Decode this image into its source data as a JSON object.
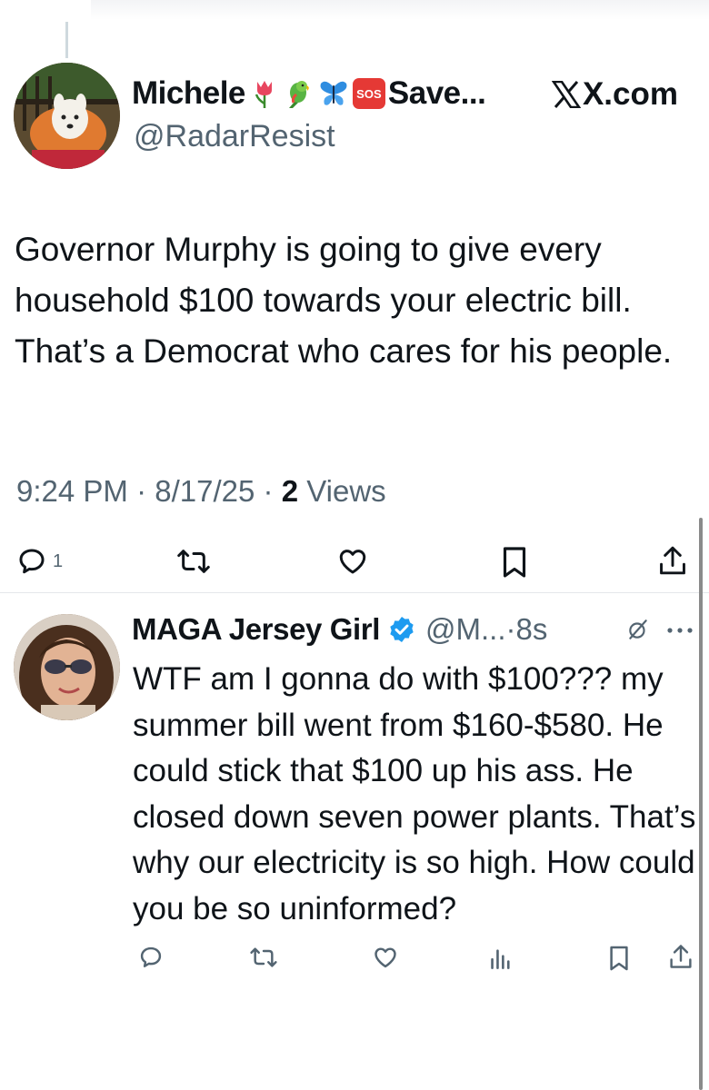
{
  "main_tweet": {
    "display_name": "Michele",
    "name_truncated": "Save...",
    "sos_label": "SOS",
    "emojis": [
      "tulip-emoji",
      "parrot-emoji",
      "butterfly-emoji"
    ],
    "handle": "@RadarResist",
    "source": "X.com",
    "text": "Governor Murphy is going to give every household $100 towards your electric bill. That’s a Democrat who cares for his people.",
    "time": "9:24 PM",
    "date": "8/17/25",
    "views_count": "2",
    "views_label": "Views",
    "separator": "·",
    "reply_count": "1"
  },
  "reply": {
    "display_name": "MAGA Jersey Girl",
    "handle": "@M...",
    "separator": "·",
    "time": "8s",
    "text": "WTF am I gonna do with $100??? my summer bill went from $160-$580. He could stick that $100 up his ass. He closed down seven power plants. That’s why our electricity is so high. How could you be so uninformed?"
  },
  "colors": {
    "text_primary": "#0f1419",
    "text_secondary": "#536471",
    "verified_blue": "#1d9bf0",
    "sos_red": "#e53935"
  }
}
